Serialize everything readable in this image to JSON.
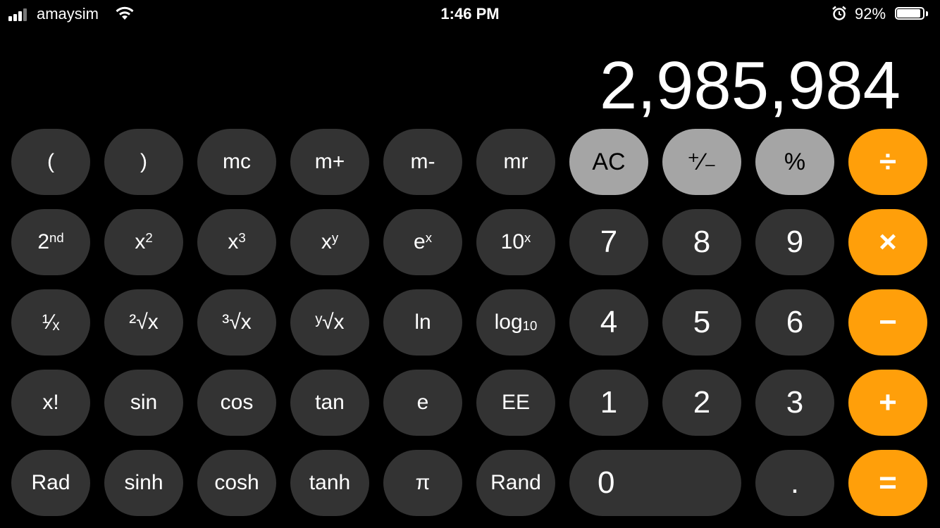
{
  "status_bar": {
    "carrier": "amaysim",
    "time": "1:46 PM",
    "battery_percent": "92%",
    "battery_level": 0.92,
    "icons": [
      "signal-icon",
      "wifi-icon",
      "alarm-icon",
      "battery-icon"
    ]
  },
  "display": {
    "value": "2,985,984"
  },
  "rows": [
    [
      {
        "name": "open-paren-button",
        "label": "(",
        "style": "sci"
      },
      {
        "name": "close-paren-button",
        "label": ")",
        "style": "sci"
      },
      {
        "name": "mc-button",
        "label": "mc",
        "style": "sci"
      },
      {
        "name": "m-plus-button",
        "label": "m+",
        "style": "sci"
      },
      {
        "name": "m-minus-button",
        "label": "m-",
        "style": "sci"
      },
      {
        "name": "mr-button",
        "label": "mr",
        "style": "sci"
      },
      {
        "name": "ac-button",
        "label": "AC",
        "style": "fn"
      },
      {
        "name": "plus-minus-button",
        "label": "⁺∕₋",
        "style": "fn"
      },
      {
        "name": "percent-button",
        "label": "%",
        "style": "fn"
      },
      {
        "name": "divide-button",
        "label": "÷",
        "style": "op"
      }
    ],
    [
      {
        "name": "second-button",
        "label": "2",
        "sup": "nd",
        "style": "sci"
      },
      {
        "name": "x-squared-button",
        "label": "x",
        "sup": "2",
        "style": "sci"
      },
      {
        "name": "x-cubed-button",
        "label": "x",
        "sup": "3",
        "style": "sci"
      },
      {
        "name": "x-to-y-button",
        "label": "x",
        "sup": "y",
        "style": "sci"
      },
      {
        "name": "e-to-x-button",
        "label": "e",
        "sup": "x",
        "style": "sci"
      },
      {
        "name": "ten-to-x-button",
        "label": "10",
        "sup": "x",
        "style": "sci"
      },
      {
        "name": "digit-7-button",
        "label": "7",
        "style": "num"
      },
      {
        "name": "digit-8-button",
        "label": "8",
        "style": "num"
      },
      {
        "name": "digit-9-button",
        "label": "9",
        "style": "num"
      },
      {
        "name": "multiply-button",
        "label": "×",
        "style": "op"
      }
    ],
    [
      {
        "name": "reciprocal-button",
        "label": "¹∕ₓ",
        "style": "sci"
      },
      {
        "name": "square-root-button",
        "label": "²√x",
        "style": "sci"
      },
      {
        "name": "cube-root-button",
        "label": "³√x",
        "style": "sci"
      },
      {
        "name": "y-root-button",
        "label": "ʸ√x",
        "style": "sci"
      },
      {
        "name": "ln-button",
        "label": "ln",
        "style": "sci"
      },
      {
        "name": "log10-button",
        "label": "log",
        "sub": "10",
        "style": "sci"
      },
      {
        "name": "digit-4-button",
        "label": "4",
        "style": "num"
      },
      {
        "name": "digit-5-button",
        "label": "5",
        "style": "num"
      },
      {
        "name": "digit-6-button",
        "label": "6",
        "style": "num"
      },
      {
        "name": "minus-button",
        "label": "−",
        "style": "op"
      }
    ],
    [
      {
        "name": "factorial-button",
        "label": "x!",
        "style": "sci"
      },
      {
        "name": "sin-button",
        "label": "sin",
        "style": "sci"
      },
      {
        "name": "cos-button",
        "label": "cos",
        "style": "sci"
      },
      {
        "name": "tan-button",
        "label": "tan",
        "style": "sci"
      },
      {
        "name": "e-button",
        "label": "e",
        "style": "sci"
      },
      {
        "name": "ee-button",
        "label": "EE",
        "style": "sci"
      },
      {
        "name": "digit-1-button",
        "label": "1",
        "style": "num"
      },
      {
        "name": "digit-2-button",
        "label": "2",
        "style": "num"
      },
      {
        "name": "digit-3-button",
        "label": "3",
        "style": "num"
      },
      {
        "name": "plus-button",
        "label": "+",
        "style": "op"
      }
    ],
    [
      {
        "name": "rad-button",
        "label": "Rad",
        "style": "sci"
      },
      {
        "name": "sinh-button",
        "label": "sinh",
        "style": "sci"
      },
      {
        "name": "cosh-button",
        "label": "cosh",
        "style": "sci"
      },
      {
        "name": "tanh-button",
        "label": "tanh",
        "style": "sci"
      },
      {
        "name": "pi-button",
        "label": "π",
        "style": "sci"
      },
      {
        "name": "rand-button",
        "label": "Rand",
        "style": "sci"
      },
      {
        "name": "digit-0-button",
        "label": "0",
        "style": "num zero"
      },
      {
        "name": "decimal-button",
        "label": ".",
        "style": "num"
      },
      {
        "name": "equals-button",
        "label": "=",
        "style": "op"
      }
    ]
  ],
  "colors": {
    "background": "#000000",
    "scientific_key": "#333333",
    "function_key": "#a5a5a5",
    "operator_key": "#ff9f0a"
  }
}
